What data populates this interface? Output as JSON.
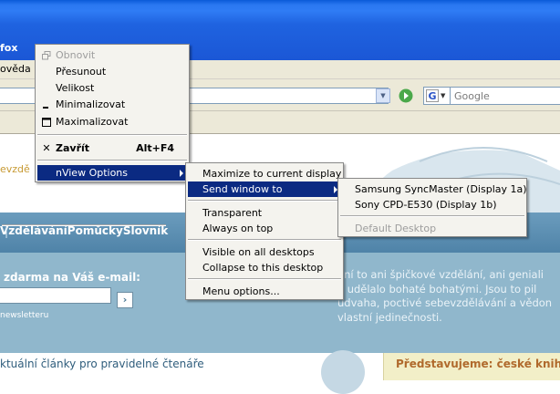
{
  "browser": {
    "title_fragment": "fox",
    "menu_fragment": "ověda",
    "search_engine_letter": "G",
    "search_placeholder": "Google"
  },
  "page": {
    "banner_text": "evzdě",
    "nav_links": [
      "Vzdělávání",
      "Pomůcky",
      "Slovník"
    ],
    "promo_label": "zdarma na Váš e-mail:",
    "submit_glyph": "›",
    "newsletter_link": "newsletteru",
    "promo_text_lines": [
      "ení to ani špičkové vzdělání, ani geniali",
      "o udělalo bohaté bohatými. Jsou to pil",
      "udvaha, poctivé sebevzdělávání a vědon",
      "vlastní jedinečnosti."
    ],
    "articles_title": "ktuální články pro pravidelné čtenáře",
    "feature_title": "Představujeme: české knihy"
  },
  "system_menu": {
    "items": [
      {
        "label": "Obnovit",
        "disabled": true,
        "icon": "restore-icon"
      },
      {
        "label": "Přesunout"
      },
      {
        "label": "Velikost"
      },
      {
        "label": "Minimalizovat",
        "icon": "minimize-icon"
      },
      {
        "label": "Maximalizovat",
        "icon": "maximize-icon"
      },
      {
        "label": "Zavřít",
        "shortcut": "Alt+F4",
        "icon": "close-icon"
      },
      {
        "label": "nView Options",
        "submenu": true
      }
    ]
  },
  "nview_menu": {
    "items": [
      {
        "label": "Maximize to current display"
      },
      {
        "label": "Send window to",
        "submenu": true
      },
      {
        "label": "Transparent"
      },
      {
        "label": "Always on top"
      },
      {
        "label": "Visible on all desktops"
      },
      {
        "label": "Collapse to this desktop"
      },
      {
        "label": "Menu options..."
      }
    ]
  },
  "send_to_menu": {
    "items": [
      {
        "label": "Samsung SyncMaster (Display 1a)"
      },
      {
        "label": "Sony CPD-E530 (Display 1b)"
      },
      {
        "label": "Default Desktop",
        "disabled": true
      }
    ]
  },
  "colors": {
    "titlebar": "#1f63e0",
    "menu_highlight": "#0b2a82",
    "nav_strip": "#5a8db2",
    "promo_bg": "#90b7cc"
  }
}
